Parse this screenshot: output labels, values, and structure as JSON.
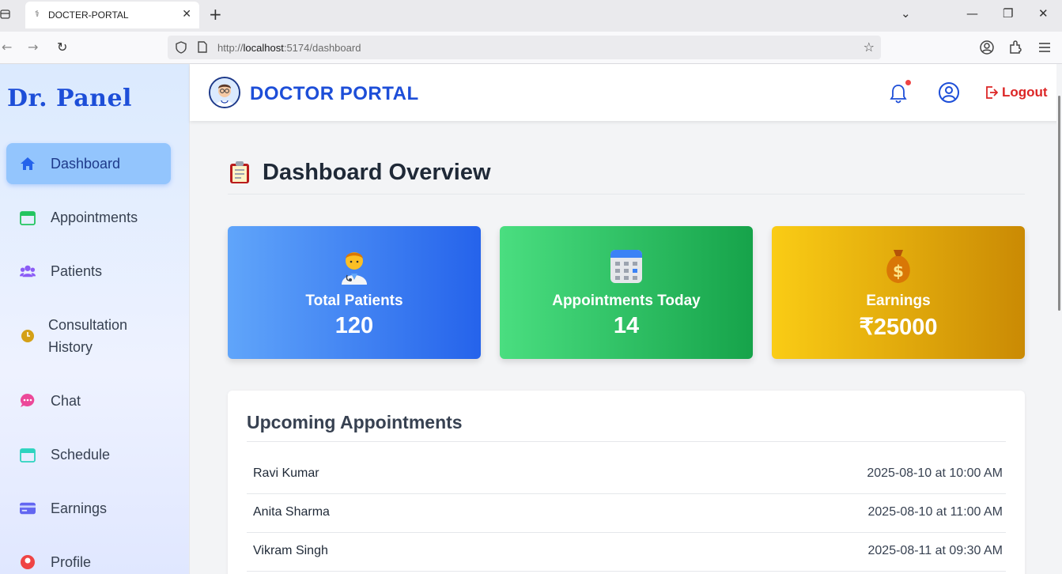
{
  "browser": {
    "tab_title": "DOCTER-PORTAL",
    "url_prefix": "http://",
    "url_host": "localhost",
    "url_path": ":5174/dashboard"
  },
  "sidebar": {
    "brand": "Dr. Panel",
    "items": [
      {
        "label": "Dashboard",
        "icon": "home-icon",
        "color": "#2563eb",
        "active": true
      },
      {
        "label": "Appointments",
        "icon": "calendar-icon",
        "color": "#22c55e"
      },
      {
        "label": "Patients",
        "icon": "users-icon",
        "color": "#8b5cf6"
      },
      {
        "label": "Consultation History",
        "icon": "clock-icon",
        "color": "#d4a017"
      },
      {
        "label": "Chat",
        "icon": "chat-icon",
        "color": "#ec4899"
      },
      {
        "label": "Schedule",
        "icon": "calendar-icon",
        "color": "#2dd4bf"
      },
      {
        "label": "Earnings",
        "icon": "credit-card-icon",
        "color": "#6366f1"
      },
      {
        "label": "Profile",
        "icon": "user-icon",
        "color": "#ef4444"
      }
    ]
  },
  "header": {
    "title": "DOCTOR PORTAL",
    "logout_label": "Logout"
  },
  "main": {
    "title": "Dashboard Overview",
    "cards": [
      {
        "label": "Total Patients",
        "value": "120",
        "icon": "doctor-emoji-icon"
      },
      {
        "label": "Appointments Today",
        "value": "14",
        "icon": "calendar-emoji-icon"
      },
      {
        "label": "Earnings",
        "value": "₹25000",
        "icon": "money-bag-emoji-icon"
      }
    ],
    "upcoming": {
      "title": "Upcoming Appointments",
      "rows": [
        {
          "name": "Ravi Kumar",
          "time": "2025-08-10 at 10:00 AM"
        },
        {
          "name": "Anita Sharma",
          "time": "2025-08-10 at 11:00 AM"
        },
        {
          "name": "Vikram Singh",
          "time": "2025-08-11 at 09:30 AM"
        }
      ]
    }
  },
  "colors": {
    "brand_blue": "#1d4ed8",
    "logout_red": "#dc2626",
    "card_blue": "#2563eb",
    "card_green": "#16a34a",
    "card_yellow": "#ca8a04"
  }
}
